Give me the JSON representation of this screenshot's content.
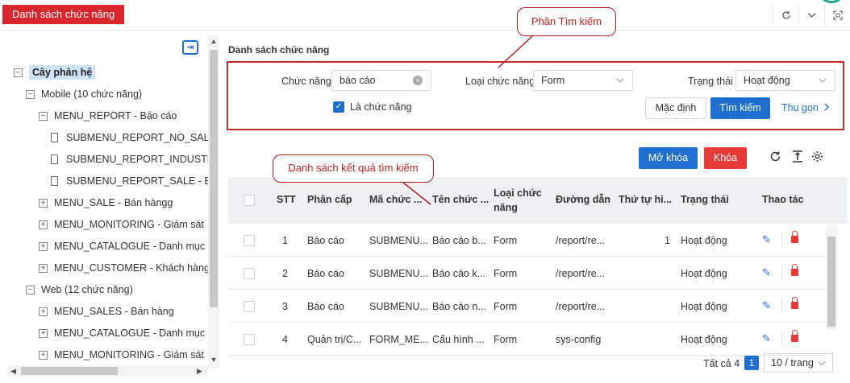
{
  "page": {
    "title": "Danh sách chức năng"
  },
  "top_icons": [
    "refresh-icon",
    "chevron-down-icon",
    "fullscreen-icon"
  ],
  "tree": {
    "root": "Cây phân hệ",
    "nodes": [
      {
        "label": "Mobile (10 chức năng)"
      },
      {
        "label": "MENU_REPORT - Báo cáo"
      },
      {
        "label": "SUBMENU_REPORT_NO_SALE - Bá"
      },
      {
        "label": "SUBMENU_REPORT_INDUSTRY - E"
      },
      {
        "label": "SUBMENU_REPORT_SALE - Báo cá"
      },
      {
        "label": "MENU_SALE - Bán hàngg"
      },
      {
        "label": "MENU_MONITORING - Giám sát"
      },
      {
        "label": "MENU_CATALOGUE - Danh mục"
      },
      {
        "label": "MENU_CUSTOMER - Khách hàng"
      },
      {
        "label": "Web (12 chức năng)"
      },
      {
        "label": "MENU_SALES - Bán hàng"
      },
      {
        "label": "MENU_CATALOGUE - Danh mục"
      },
      {
        "label": "MENU_MONITORING - Giám sát"
      }
    ]
  },
  "search": {
    "section_title": "Danh sách chức năng",
    "function_label": "Chức năng",
    "function_value": "báo cáo",
    "type_label": "Loại chức năng",
    "type_value": "Form",
    "status_label": "Trạng thái",
    "status_value": "Hoạt động",
    "is_function_label": "Là chức năng",
    "default_button": "Mặc định",
    "search_button": "Tìm kiếm",
    "collapse_link": "Thu gọn"
  },
  "callouts": {
    "search_area": "Phần Tìm kiếm",
    "result_list": "Danh sách kết quả tìm kiếm"
  },
  "toolbar": {
    "unlock_button": "Mở khóa",
    "lock_button": "Khóa"
  },
  "table": {
    "headers": {
      "stt": "STT",
      "level": "Phân cấp",
      "code": "Mã chức ...",
      "name": "Tên chức ...",
      "type_line1": "Loại chức",
      "type_line2": "năng",
      "path": "Đường dẫn",
      "order": "Thứ tự hi...",
      "status": "Trạng thái",
      "actions": "Thao tác"
    },
    "rows": [
      {
        "stt": "1",
        "level": "Báo cáo",
        "code": "SUBMENU...",
        "name": "Báo cáo b...",
        "type": "Form",
        "path": "/report/re...",
        "order": "1",
        "status": "Hoạt động"
      },
      {
        "stt": "2",
        "level": "Báo cáo",
        "code": "SUBMENU...",
        "name": "Báo cáo k...",
        "type": "Form",
        "path": "/report/re...",
        "order": "",
        "status": "Hoạt động"
      },
      {
        "stt": "3",
        "level": "Báo cáo",
        "code": "SUBMENU...",
        "name": "Báo cáo n...",
        "type": "Form",
        "path": "/report/re...",
        "order": "",
        "status": "Hoạt động"
      },
      {
        "stt": "4",
        "level": "Quản trị/C...",
        "code": "FORM_ME...",
        "name": "Cấu hình ...",
        "type": "Form",
        "path": "sys-config",
        "order": "",
        "status": "Hoạt động"
      }
    ]
  },
  "pagination": {
    "total": "Tất cả 4",
    "current_page": "1",
    "page_size": "10 / trang"
  },
  "colors": {
    "brand_red": "#d9262c",
    "primary_blue": "#1e6fd0",
    "danger_red": "#e53a35",
    "callout_red": "#c41e1e"
  }
}
